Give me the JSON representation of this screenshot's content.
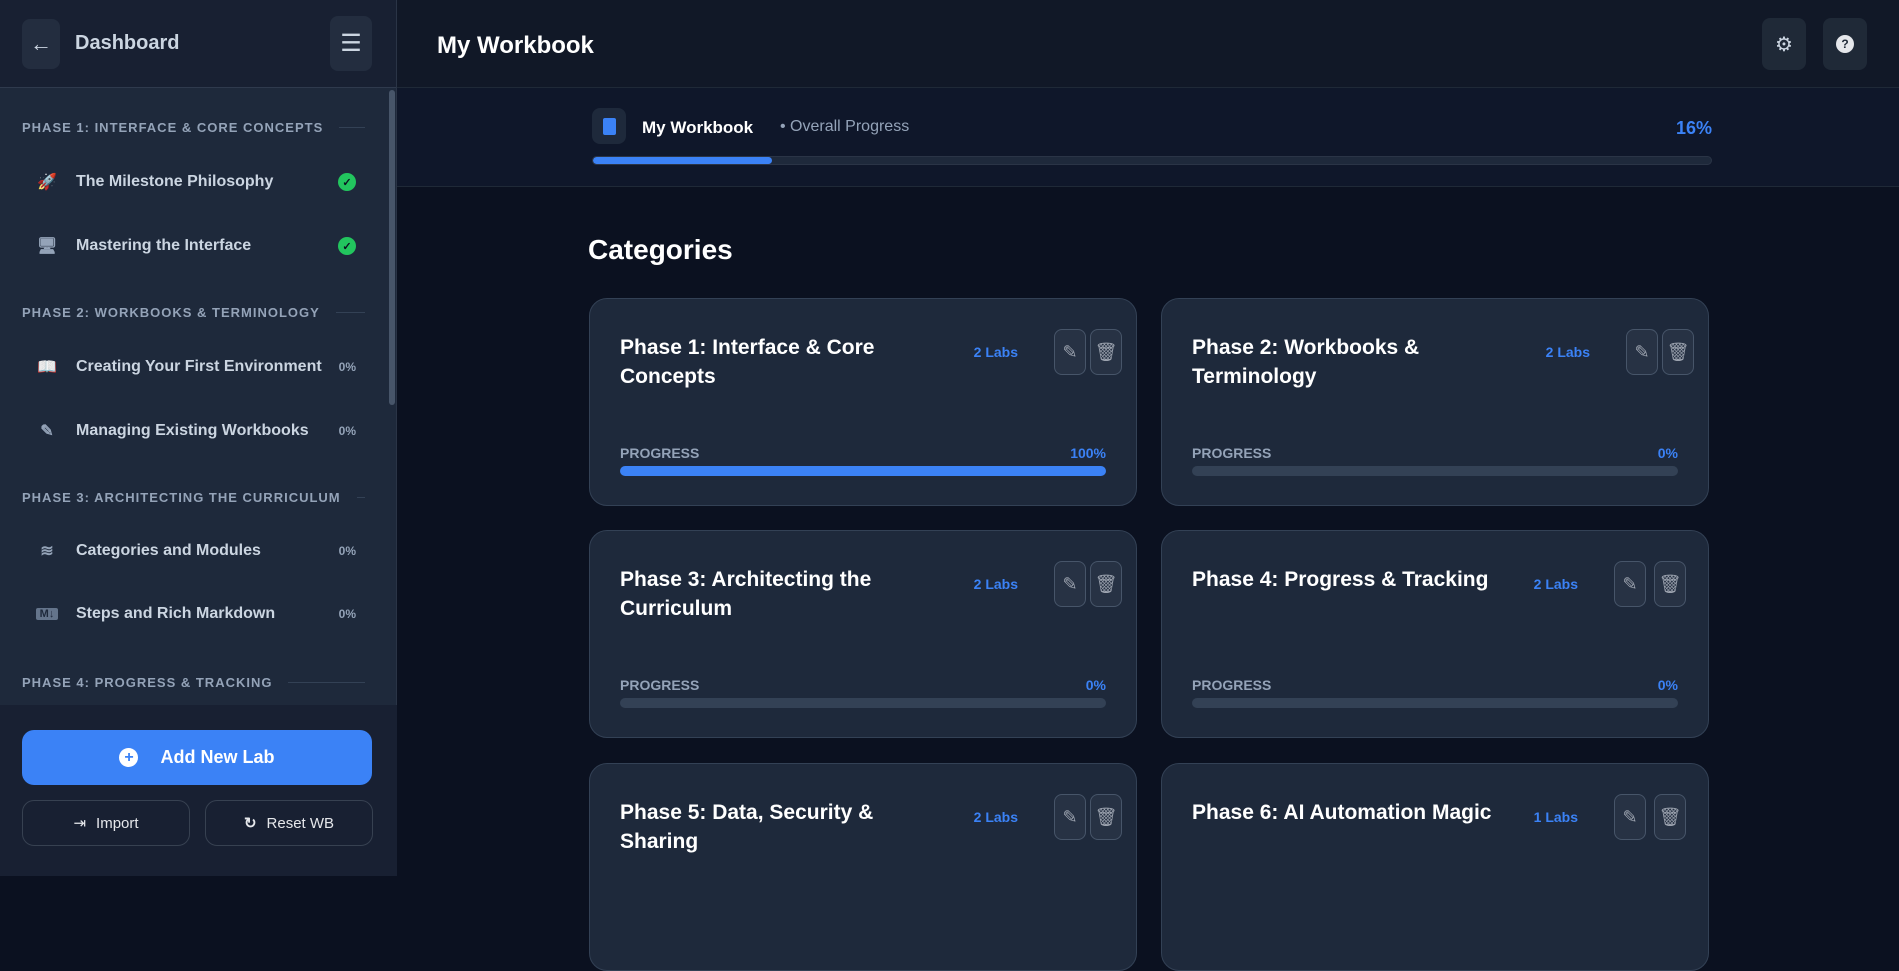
{
  "sidebar": {
    "title": "Dashboard",
    "phases": [
      {
        "label": "PHASE 1: INTERFACE & CORE CONCEPTS",
        "items": [
          {
            "label": "The Milestone Philosophy",
            "icon": "rocket-icon",
            "status": "done"
          },
          {
            "label": "Mastering the Interface",
            "icon": "monitor-icon",
            "status": "done"
          }
        ]
      },
      {
        "label": "PHASE 2: WORKBOOKS & TERMINOLOGY",
        "items": [
          {
            "label": "Creating Your First Environment",
            "icon": "book-open-icon",
            "pct": "0%"
          },
          {
            "label": "Managing Existing Workbooks",
            "icon": "edit-icon",
            "pct": "0%"
          }
        ]
      },
      {
        "label": "PHASE 3: ARCHITECTING THE CURRICULUM",
        "items": [
          {
            "label": "Categories and Modules",
            "icon": "layers-icon",
            "pct": "0%"
          },
          {
            "label": "Steps and Rich Markdown",
            "icon": "markdown-icon",
            "pct": "0%"
          }
        ]
      },
      {
        "label": "PHASE 4: PROGRESS & TRACKING",
        "items": []
      }
    ],
    "add_label": "Add New Lab",
    "import_label": "Import",
    "reset_label": "Reset WB"
  },
  "header": {
    "title": "My Workbook"
  },
  "overall": {
    "name": "My Workbook",
    "subtitle": "• Overall Progress",
    "pct_label": "16%",
    "pct": 16
  },
  "categories": {
    "heading": "Categories",
    "progress_label": "PROGRESS",
    "cards": [
      {
        "title": "Phase 1: Interface & Core Concepts",
        "labs": "2 Labs",
        "pct_label": "100%",
        "pct": 100
      },
      {
        "title": "Phase 2: Workbooks & Terminology",
        "labs": "2 Labs",
        "pct_label": "0%",
        "pct": 0
      },
      {
        "title": "Phase 3: Architecting the Curriculum",
        "labs": "2 Labs",
        "pct_label": "0%",
        "pct": 0
      },
      {
        "title": "Phase 4: Progress & Tracking",
        "labs": "2 Labs",
        "pct_label": "0%",
        "pct": 0
      },
      {
        "title": "Phase 5: Data, Security & Sharing",
        "labs": "2 Labs",
        "pct_label": "",
        "pct": null
      },
      {
        "title": "Phase 6: AI Automation Magic",
        "labs": "1 Labs",
        "pct_label": "",
        "pct": null
      }
    ]
  },
  "colors": {
    "accent": "#3b82f6",
    "success": "#22c55e"
  }
}
